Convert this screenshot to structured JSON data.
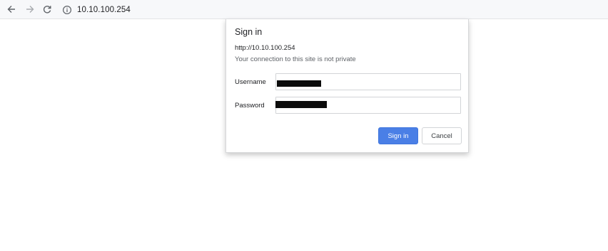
{
  "browser": {
    "url": "10.10.100.254",
    "icons": {
      "back": "back-arrow-icon",
      "forward": "forward-arrow-icon",
      "reload": "reload-icon",
      "info": "info-icon"
    }
  },
  "dialog": {
    "title": "Sign in",
    "origin": "http://10.10.100.254",
    "warning": "Your connection to this site is not private",
    "username_label": "Username",
    "password_label": "Password",
    "username_value": "",
    "password_value": "",
    "signin_label": "Sign in",
    "cancel_label": "Cancel"
  },
  "colors": {
    "accent": "#4a7fe6",
    "toolbar_bg": "#f7f8fa"
  }
}
